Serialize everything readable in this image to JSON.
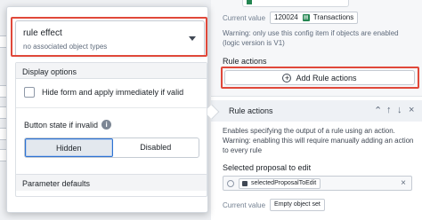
{
  "rule_effect_select": {
    "value": "rule effect",
    "subtitle": "no associated object types"
  },
  "display_options": {
    "header": "Display options",
    "checkbox_label": "Hide form and apply immediately if valid",
    "checked": false,
    "button_state_label": "Button state if invalid",
    "info_glyph": "i",
    "options": [
      "Hidden",
      "Disabled"
    ],
    "selected": "Hidden"
  },
  "parameter_defaults": {
    "header": "Parameter defaults"
  },
  "right_panel": {
    "current_value_label": "Current value",
    "current_value_id": "120024",
    "current_value_type": "Transactions",
    "warning": "Warning: only use this config item if objects are enabled (logic version is V1)",
    "rule_actions_label": "Rule actions",
    "add_button_label": "Add Rule actions",
    "card": {
      "title": "Rule actions",
      "description": "Enables specifying the output of a rule using an action. Warning: enabling this will require manually adding an action to every rule",
      "selected_proposal_label": "Selected proposal to edit",
      "proposal_chip": "selectedProposalToEdit",
      "current_value_label": "Current value",
      "current_value": "Empty object set"
    }
  },
  "colors": {
    "highlight": "#e0483a",
    "accent": "#2d72d2",
    "object_green": "#238551"
  },
  "icons": [
    "chevron-down-icon",
    "info-icon",
    "plus-circle-icon",
    "chevron-up-icon",
    "arrow-up-icon",
    "arrow-down-icon",
    "close-icon",
    "object-icon"
  ]
}
